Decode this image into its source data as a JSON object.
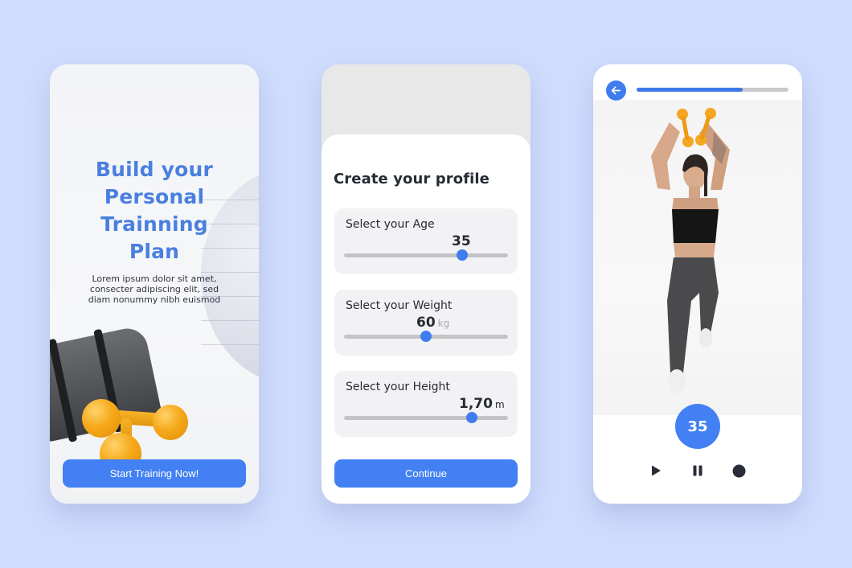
{
  "colors": {
    "background": "#cfdcfd",
    "accent": "#4280f3",
    "title_blue": "#4a7fe0",
    "text_dark": "#262a33"
  },
  "screen_welcome": {
    "title_lines": [
      "Build your",
      "Personal",
      "Trainning",
      "Plan"
    ],
    "body_lines": [
      "Lorem ipsum dolor sit amet,",
      "consecter adipiscing elit, sed",
      "diam nonummy nibh euismod"
    ],
    "cta_label": "Start Training Now!",
    "image_subject": "yoga mat, orange dumbbells and exercise ball"
  },
  "screen_profile": {
    "title": "Create your profile",
    "fields": [
      {
        "label": "Select your Age",
        "value": "35",
        "unit": "",
        "slider_fraction": 0.72
      },
      {
        "label": "Select your Weight",
        "value": "60",
        "unit": "kg",
        "slider_fraction": 0.5
      },
      {
        "label": "Select your Height",
        "value": "1,70",
        "unit": "m",
        "slider_fraction": 0.78
      }
    ],
    "continue_label": "Continue"
  },
  "screen_workout": {
    "back_icon": "arrow-left-icon",
    "progress_fraction": 0.7,
    "image_subject": "woman doing lunge with dumbbells overhead",
    "counter_value": "35",
    "controls": [
      {
        "name": "play-icon",
        "glyph": "play"
      },
      {
        "name": "pause-icon",
        "glyph": "pause"
      },
      {
        "name": "record-icon",
        "glyph": "record"
      }
    ]
  }
}
